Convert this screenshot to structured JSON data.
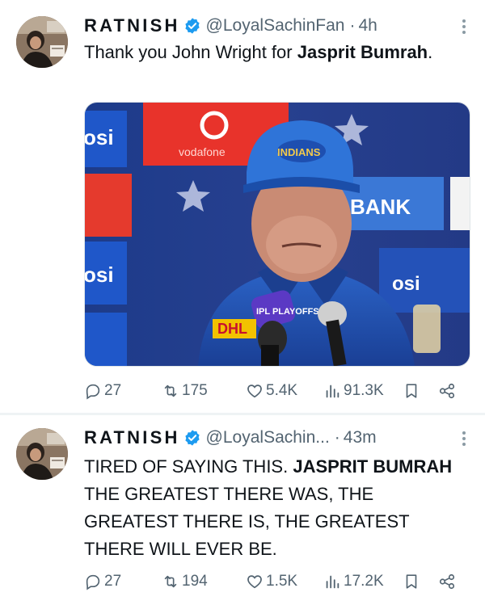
{
  "tweets": [
    {
      "display_name": "RATNISH",
      "handle": "@LoyalSachinFan",
      "separator": "·",
      "time": "4h",
      "text_plain": "Thank you John Wright for ",
      "text_bold": "Jasprit Bumrah",
      "text_tail": ".",
      "metrics": {
        "replies": "27",
        "reposts": "175",
        "likes": "5.4K",
        "views": "91.3K"
      },
      "media_text": {
        "cap_logo": "INDIANS",
        "sponsor": "DHL",
        "bank": "BANK",
        "vodafone": "vodafone",
        "ipl": "IPL PLAYOFFS"
      }
    },
    {
      "display_name": "RATNISH",
      "handle": "@LoyalSachin...",
      "separator": "·",
      "time": "43m",
      "text_plain": "TIRED OF SAYING THIS. ",
      "text_bold": "JASPRIT BUMRAH",
      "text_tail": " THE GREATEST THERE WAS, THE GREATEST THERE IS, THE GREATEST THERE WILL EVER BE.",
      "metrics": {
        "replies": "27",
        "reposts": "194",
        "likes": "1.5K",
        "views": "17.2K"
      }
    }
  ],
  "colors": {
    "verified": "#1d9bf0",
    "secondary_text": "#536471",
    "primary_text": "#0f1419",
    "divider": "#eff3f4"
  },
  "icons": [
    "reply-icon",
    "repost-icon",
    "like-icon",
    "views-icon",
    "bookmark-icon",
    "share-icon",
    "more-icon",
    "verified-badge-icon"
  ]
}
